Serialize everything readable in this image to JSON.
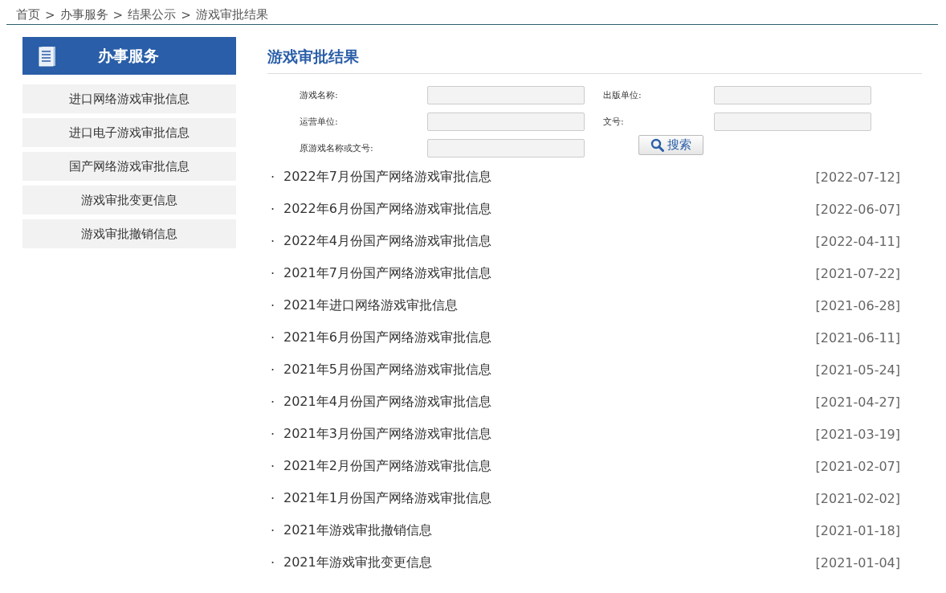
{
  "breadcrumb": {
    "separator": ">",
    "items": [
      "首页",
      "办事服务",
      "结果公示",
      "游戏审批结果"
    ]
  },
  "sidebar": {
    "title": "办事服务",
    "items": [
      "进口网络游戏审批信息",
      "进口电子游戏审批信息",
      "国产网络游戏审批信息",
      "游戏审批变更信息",
      "游戏审批撤销信息"
    ]
  },
  "main": {
    "title": "游戏审批结果",
    "form": {
      "fields": [
        {
          "label": "游戏名称:"
        },
        {
          "label": "出版单位:"
        },
        {
          "label": "运营单位:"
        },
        {
          "label": "文号:"
        },
        {
          "label": "原游戏名称或文号:"
        }
      ],
      "search_button": "搜索"
    },
    "bullet": "·",
    "articles": [
      {
        "title": "2022年7月份国产网络游戏审批信息",
        "date": "[2022-07-12]"
      },
      {
        "title": "2022年6月份国产网络游戏审批信息",
        "date": "[2022-06-07]"
      },
      {
        "title": "2022年4月份国产网络游戏审批信息",
        "date": "[2022-04-11]"
      },
      {
        "title": "2021年7月份国产网络游戏审批信息",
        "date": "[2021-07-22]"
      },
      {
        "title": "2021年进口网络游戏审批信息",
        "date": "[2021-06-28]"
      },
      {
        "title": "2021年6月份国产网络游戏审批信息",
        "date": "[2021-06-11]"
      },
      {
        "title": "2021年5月份国产网络游戏审批信息",
        "date": "[2021-05-24]"
      },
      {
        "title": "2021年4月份国产网络游戏审批信息",
        "date": "[2021-04-27]"
      },
      {
        "title": "2021年3月份国产网络游戏审批信息",
        "date": "[2021-03-19]"
      },
      {
        "title": "2021年2月份国产网络游戏审批信息",
        "date": "[2021-02-07]"
      },
      {
        "title": "2021年1月份国产网络游戏审批信息",
        "date": "[2021-02-02]"
      },
      {
        "title": "2021年游戏审批撤销信息",
        "date": "[2021-01-18]"
      },
      {
        "title": "2021年游戏审批变更信息",
        "date": "[2021-01-04]"
      }
    ]
  }
}
